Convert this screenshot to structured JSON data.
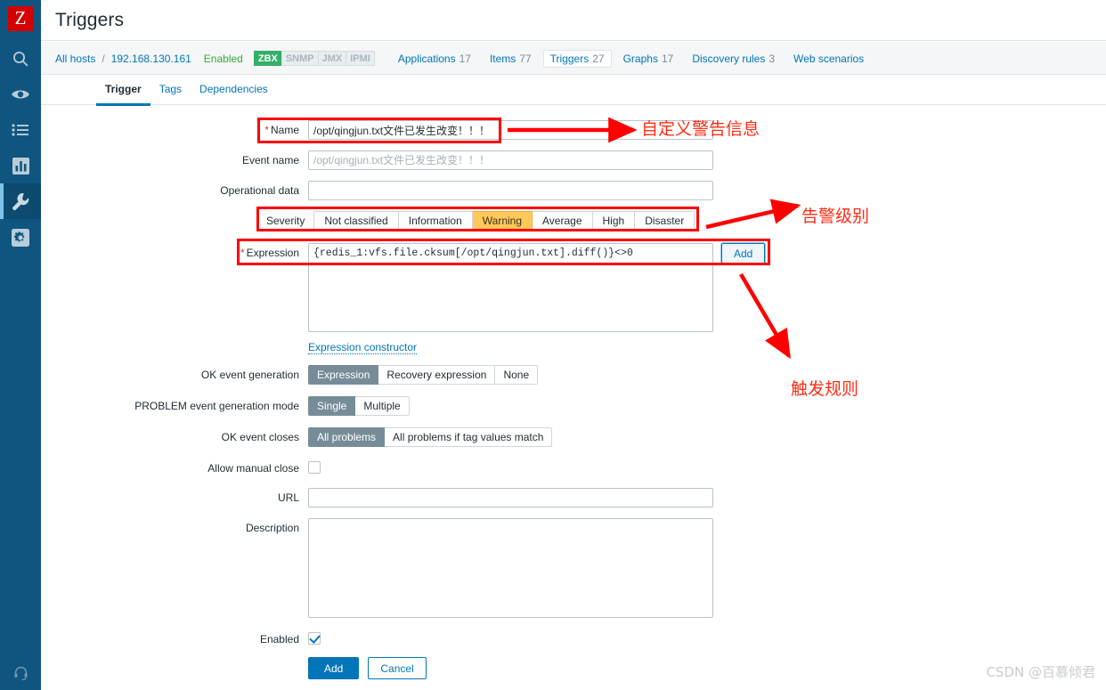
{
  "app": {
    "logo_letter": "Z",
    "page_title": "Triggers",
    "watermark": "CSDN @百慕倾君"
  },
  "sidebar": {
    "items": [
      {
        "name": "search-icon",
        "label": "Search"
      },
      {
        "name": "monitoring-icon",
        "label": "Monitoring"
      },
      {
        "name": "list-icon",
        "label": "Inventory"
      },
      {
        "name": "reports-icon",
        "label": "Reports"
      },
      {
        "name": "configuration-icon",
        "label": "Configuration",
        "active": true
      },
      {
        "name": "administration-icon",
        "label": "Administration"
      }
    ],
    "support": {
      "name": "support-icon",
      "label": "Support"
    }
  },
  "breadcrumb": {
    "all_hosts": "All hosts",
    "separator": "/",
    "host": "192.168.130.161",
    "status": "Enabled",
    "protocols": [
      {
        "label": "ZBX",
        "enabled": true
      },
      {
        "label": "SNMP",
        "enabled": false
      },
      {
        "label": "JMX",
        "enabled": false
      },
      {
        "label": "IPMI",
        "enabled": false
      }
    ],
    "links": [
      {
        "label": "Applications",
        "count": "17",
        "current": false
      },
      {
        "label": "Items",
        "count": "77",
        "current": false
      },
      {
        "label": "Triggers",
        "count": "27",
        "current": true
      },
      {
        "label": "Graphs",
        "count": "17",
        "current": false
      },
      {
        "label": "Discovery rules",
        "count": "3",
        "current": false
      },
      {
        "label": "Web scenarios",
        "count": "",
        "current": false
      }
    ]
  },
  "tabs": [
    {
      "label": "Trigger",
      "active": true
    },
    {
      "label": "Tags",
      "active": false
    },
    {
      "label": "Dependencies",
      "active": false
    }
  ],
  "form": {
    "name": {
      "label": "Name",
      "required": "*",
      "value": "/opt/qingjun.txt文件已发生改变！！！"
    },
    "event_name": {
      "label": "Event name",
      "value": "",
      "placeholder": "/opt/qingjun.txt文件已发生改变！！！"
    },
    "operational_data": {
      "label": "Operational data",
      "value": "",
      "placeholder": ""
    },
    "severity": {
      "label": "Severity",
      "options": [
        "Not classified",
        "Information",
        "Warning",
        "Average",
        "High",
        "Disaster"
      ],
      "selected": "Warning"
    },
    "expression": {
      "label": "Expression",
      "required": "*",
      "value": "{redis_1:vfs.file.cksum[/opt/qingjun.txt].diff()}<>0",
      "add_button": "Add",
      "constructor_link": "Expression constructor"
    },
    "ok_event_generation": {
      "label": "OK event generation",
      "options": [
        "Expression",
        "Recovery expression",
        "None"
      ],
      "selected": "Expression"
    },
    "problem_event_generation_mode": {
      "label": "PROBLEM event generation mode",
      "options": [
        "Single",
        "Multiple"
      ],
      "selected": "Single"
    },
    "ok_event_closes": {
      "label": "OK event closes",
      "options": [
        "All problems",
        "All problems if tag values match"
      ],
      "selected": "All problems"
    },
    "allow_manual_close": {
      "label": "Allow manual close",
      "checked": false
    },
    "url": {
      "label": "URL",
      "value": "",
      "placeholder": ""
    },
    "description": {
      "label": "Description",
      "value": "",
      "placeholder": ""
    },
    "enabled": {
      "label": "Enabled",
      "checked": true
    },
    "submit": "Add",
    "cancel": "Cancel"
  },
  "annotations": {
    "accent_color": "#ff0000",
    "notes": [
      {
        "text": "自定义警告信息",
        "target": "name-field"
      },
      {
        "text": "告警级别",
        "target": "severity-field"
      },
      {
        "text": "触发规则",
        "target": "expression-field"
      }
    ]
  }
}
